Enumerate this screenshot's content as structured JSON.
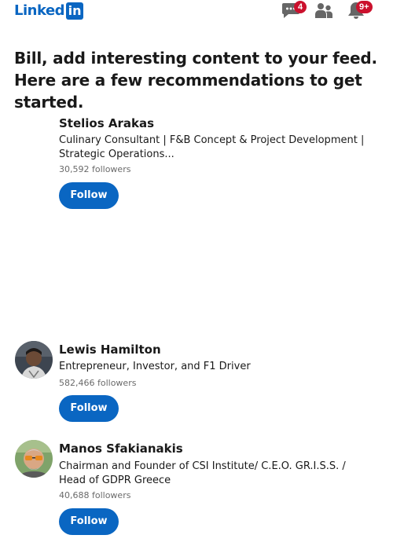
{
  "header": {
    "logo_text": "Linked",
    "logo_box": "in",
    "icons": {
      "messaging": "chat-bubble-icon",
      "network": "people-icon",
      "notifications": "bell-icon"
    },
    "messaging_badge": "4",
    "notifications_badge": "9+",
    "brand_color": "#0a66c2",
    "badge_color": "#cb112d"
  },
  "main": {
    "headline": "Bill, add interesting content to your feed. Here are a few recommendations to get started.",
    "recommendations": [
      {
        "name": "Stelios Arakas",
        "headline": "Culinary Consultant | F&B Concept & Project Development | Strategic Operations...",
        "followers": "30,592 followers",
        "follow_label": "Follow",
        "avatar": "none"
      },
      {
        "name": "Lewis Hamilton",
        "headline": "Entrepreneur, Investor, and F1 Driver",
        "followers": "582,466 followers",
        "follow_label": "Follow",
        "avatar": "profile-photo"
      },
      {
        "name": "Manos Sfakianakis",
        "headline": "Chairman and Founder of CSI Institute/ C.E.O. GR.I.S.S. / Head of GDPR Greece",
        "followers": "40,688 followers",
        "follow_label": "Follow",
        "avatar": "profile-photo"
      }
    ]
  }
}
